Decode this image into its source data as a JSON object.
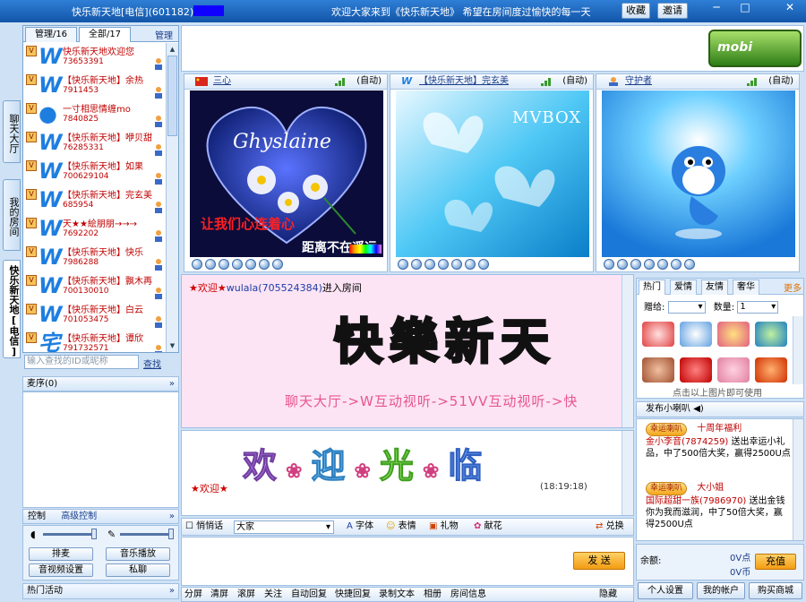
{
  "titlebar": {
    "title": "快乐新天地[电信](601182) -",
    "welcome": "欢迎大家来到《快乐新天地》 希望在房间度过愉快的每一天",
    "buttons": [
      "收藏",
      "邀请"
    ],
    "win": [
      "─",
      "□",
      "✕"
    ]
  },
  "side_tabs": [
    "聊天大厅",
    "我的房间",
    "快乐新天地[电信]"
  ],
  "userpanel": {
    "tabs": [
      "管理/16",
      "全部/17"
    ],
    "manage": "管理",
    "users": [
      {
        "name": "快乐新天地欢迎您",
        "id": "73653391",
        "avatar": "W"
      },
      {
        "name": "【快乐新天地】余热",
        "id": "7911453",
        "avatar": "W"
      },
      {
        "name": "一寸相思情缠mo",
        "id": "7840825",
        "avatar": "●"
      },
      {
        "name": "【快乐新天地】咿贝甜",
        "id": "76285331",
        "avatar": "W"
      },
      {
        "name": "【快乐新天地】如果",
        "id": "700629104",
        "avatar": "W"
      },
      {
        "name": "【快乐新天地】完玄美",
        "id": "685954",
        "avatar": "W"
      },
      {
        "name": "天★★絵朋朋→→→",
        "id": "7692202",
        "avatar": "W"
      },
      {
        "name": "【快乐新天地】快乐",
        "id": "7986288",
        "avatar": "W"
      },
      {
        "name": "【快乐新天地】飘木再",
        "id": "700130010",
        "avatar": "W"
      },
      {
        "name": "【快乐新天地】白云",
        "id": "701053475",
        "avatar": "W"
      },
      {
        "name": "【快乐新天地】谭欣",
        "id": "791732571",
        "avatar": "宅"
      }
    ],
    "find_placeholder": "输入查找的ID或昵称",
    "find_link": "查找"
  },
  "mic_header": "麦序(0)",
  "controls": {
    "tabs": [
      "控制",
      "高级控制"
    ],
    "buttons": [
      "排麦",
      "音乐播放",
      "音视频设置",
      "私聊"
    ]
  },
  "hot": "热门活动",
  "videos": [
    {
      "name": "三心",
      "auto": "(自动)",
      "caption1": "让我们心连着心",
      "caption2": "距离不在遥远",
      "art": "Ghyslaine"
    },
    {
      "name": "【快乐新天地】完玄美",
      "auto": "(自动)",
      "art": "MVBOX"
    },
    {
      "name": "守护者",
      "auto": "(自动)"
    }
  ],
  "public_chat": {
    "prefix": "★欢迎★",
    "user": "wulala(705524384)",
    "suffix": "进入房间",
    "big": "快樂新天",
    "marquee": "聊天大厅->W互动视听->51VV互动视听->快"
  },
  "private_chat": {
    "welcome_chars": [
      "欢",
      "迎",
      "光",
      "临"
    ],
    "prefix": "★欢迎★",
    "time": "(18:19:18)"
  },
  "toolbar": {
    "whisper": "悄悄话",
    "target": "大家",
    "items": [
      "字体",
      "表情",
      "礼物",
      "献花",
      "兑换"
    ]
  },
  "send": "发 送",
  "bottom_bar": [
    "分屏",
    "清屏",
    "滚屏",
    "关注",
    "自动回复",
    "快捷回复",
    "录制文本",
    "相册",
    "房间信息",
    "隐藏"
  ],
  "gifts": {
    "tabs": [
      "热门",
      "爱情",
      "友情",
      "奢华"
    ],
    "more": "更多",
    "gift_label": "赠给:",
    "count_label": "数量:",
    "count": "1",
    "hint": "点击以上图片即可使用"
  },
  "speaker": {
    "header": "发布小喇叭",
    "messages": [
      {
        "tag": "幸运喇叭",
        "badge": "十周年福利",
        "who": "金小李音(7874259)",
        "text": "送出幸运小礼品，中了500倍大奖，赢得2500U点"
      },
      {
        "tag": "幸运喇叭",
        "badge": "大小姐",
        "who": "国际超甜一族(7986970)",
        "text": "送出金钱你为我而滋润，中了50倍大奖，赢得2500U点"
      }
    ]
  },
  "balance": {
    "label": "余额:",
    "v1": "0V点",
    "v2": "0V币",
    "recharge": "充值"
  },
  "right_buttons": [
    "个人设置",
    "我的帐户",
    "购买商城"
  ],
  "colors": {
    "accent": "#1255a8",
    "highlight": "#d00000",
    "chat_bg": "#fce4f4"
  }
}
